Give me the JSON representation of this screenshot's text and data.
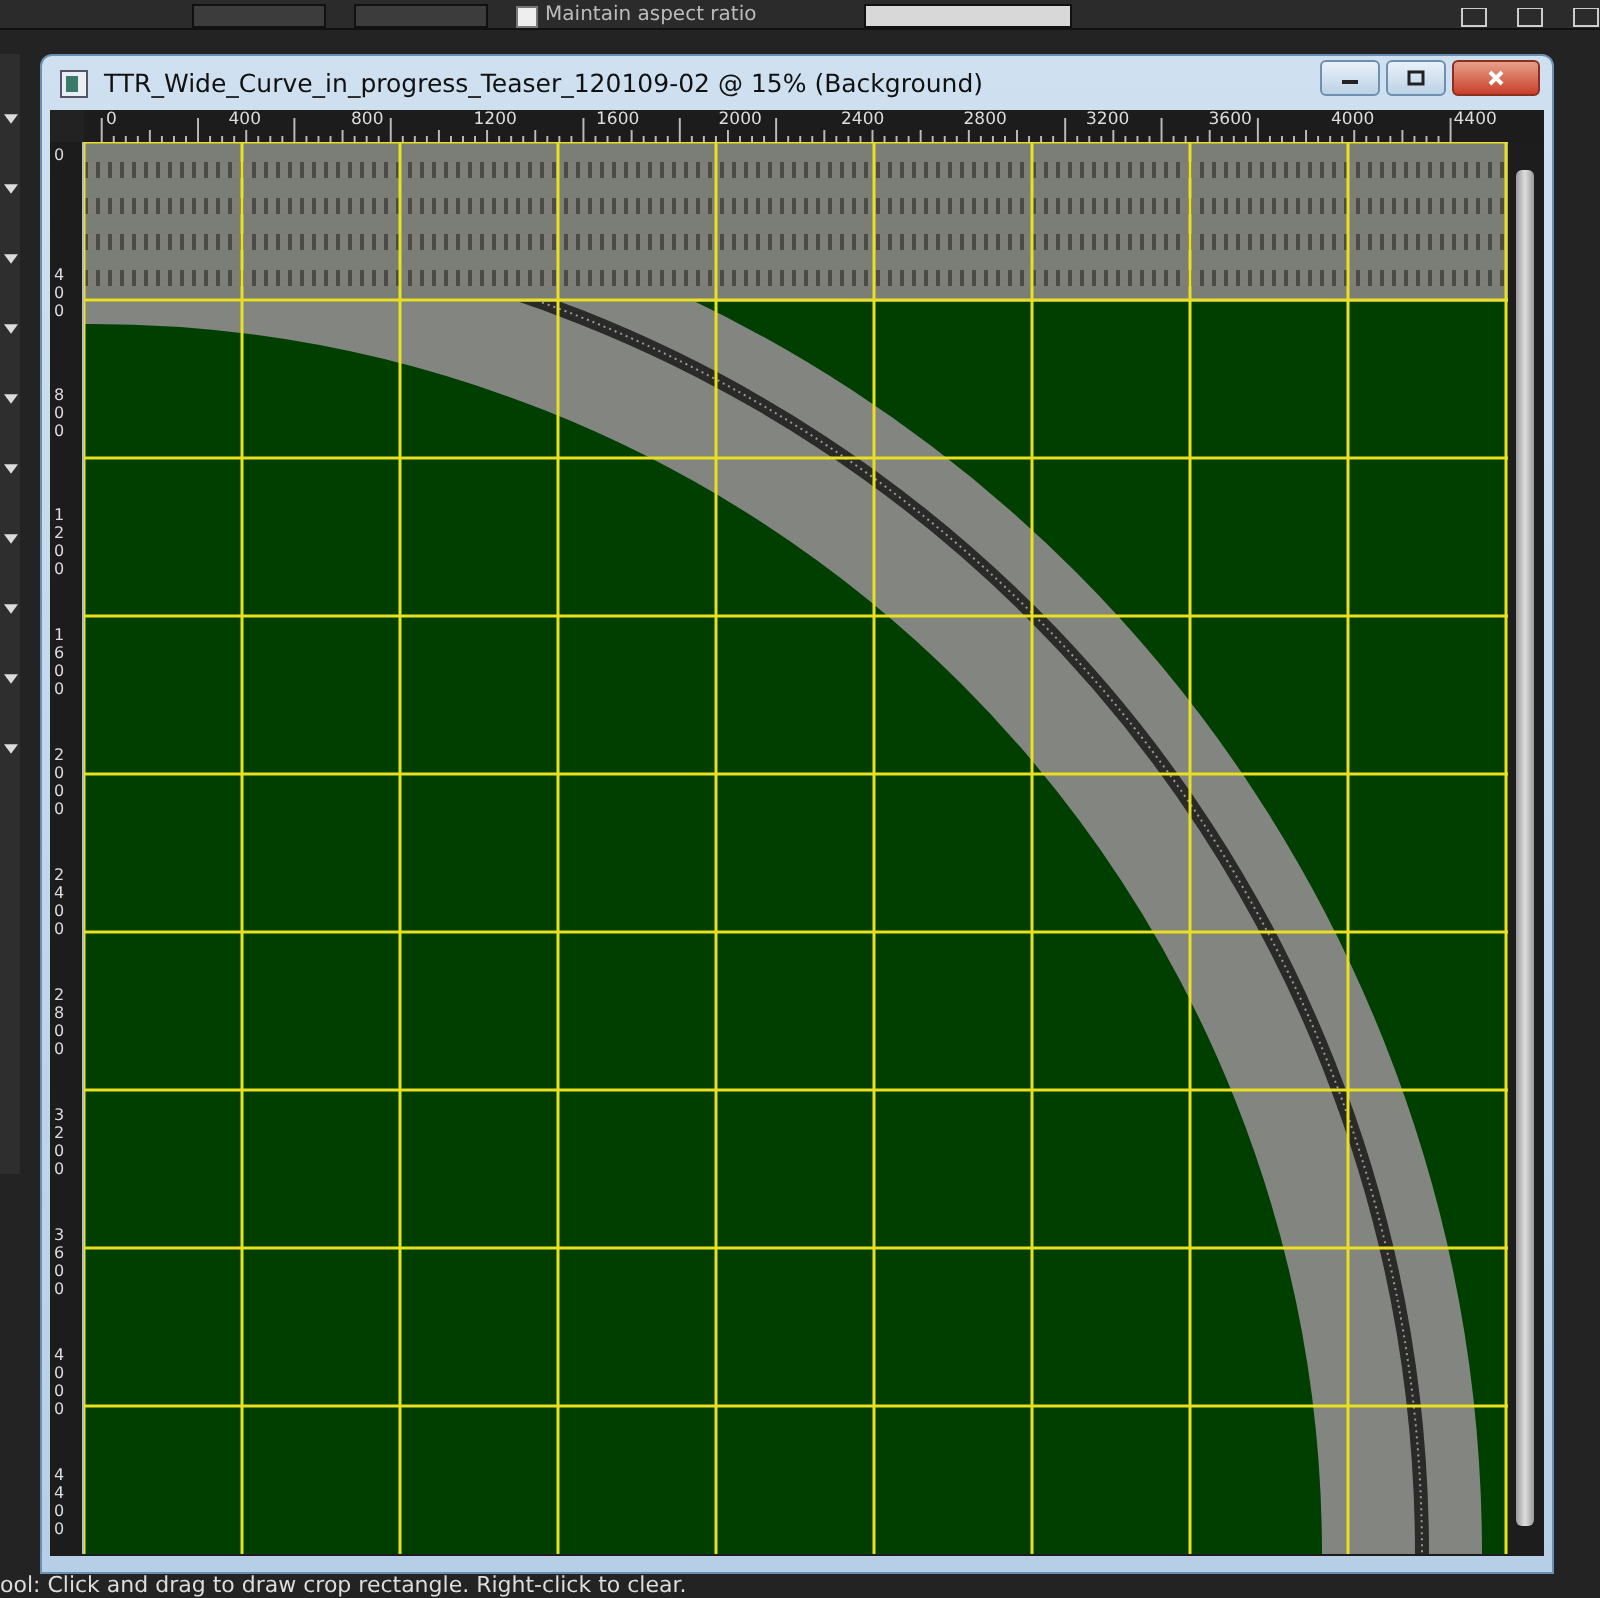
{
  "toolbar": {
    "aspect_checkbox": {
      "label": "Maintain aspect ratio",
      "checked": false
    }
  },
  "window": {
    "title": "TTR_Wide_Curve_in_progress_Teaser_120109-02 @  15% (Background)"
  },
  "ruler_top": {
    "labels": [
      "0",
      "400",
      "800",
      "1200",
      "1600",
      "2000",
      "2400",
      "2800",
      "3200",
      "3600",
      "4000",
      "4400"
    ]
  },
  "ruler_left": {
    "labels": [
      "0",
      "400",
      "800",
      "1200",
      "1600",
      "2000",
      "2400",
      "2800",
      "3200",
      "3600",
      "4000",
      "4400"
    ]
  },
  "status_bar": {
    "text": "ool: Click and drag to draw crop rectangle. Right-click to clear."
  }
}
